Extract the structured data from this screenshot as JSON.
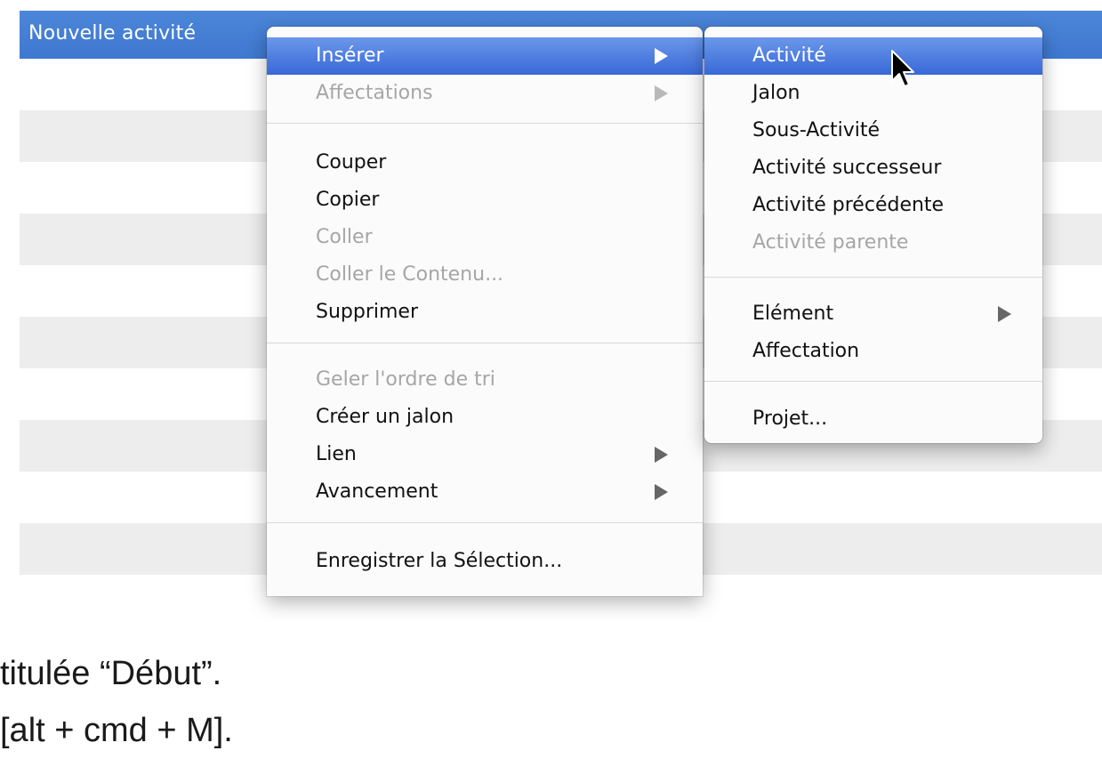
{
  "table": {
    "selected_row_title": "Nouvelle activité"
  },
  "context_menu": {
    "items": [
      {
        "label": "Insérer",
        "submenu": true,
        "state": "highlighted"
      },
      {
        "label": "Affectations",
        "submenu": true,
        "state": "disabled"
      },
      {
        "label": "Couper",
        "state": "enabled"
      },
      {
        "label": "Copier",
        "state": "enabled"
      },
      {
        "label": "Coller",
        "state": "disabled"
      },
      {
        "label": "Coller le Contenu...",
        "state": "disabled"
      },
      {
        "label": "Supprimer",
        "state": "enabled"
      },
      {
        "label": "Geler l'ordre de tri",
        "state": "disabled"
      },
      {
        "label": "Créer un jalon",
        "state": "enabled"
      },
      {
        "label": "Lien",
        "submenu": true,
        "state": "enabled"
      },
      {
        "label": "Avancement",
        "submenu": true,
        "state": "enabled"
      },
      {
        "label": "Enregistrer la Sélection...",
        "state": "enabled"
      }
    ]
  },
  "submenu_inserer": {
    "items": [
      {
        "label": "Activité",
        "state": "highlighted"
      },
      {
        "label": "Jalon",
        "state": "enabled"
      },
      {
        "label": "Sous-Activité",
        "state": "enabled"
      },
      {
        "label": "Activité successeur",
        "state": "enabled"
      },
      {
        "label": "Activité précédente",
        "state": "enabled"
      },
      {
        "label": "Activité parente",
        "state": "disabled"
      },
      {
        "label": "Elément",
        "submenu": true,
        "state": "enabled"
      },
      {
        "label": "Affectation",
        "state": "enabled"
      },
      {
        "label": "Projet...",
        "state": "enabled"
      }
    ]
  },
  "caption": {
    "line1": "titulée “Début”.",
    "line2": "[alt + cmd + M]."
  },
  "colors": {
    "selection_blue": "#3f78cf",
    "menu_highlight": "#3868d8",
    "disabled_text": "#a6a6a6"
  },
  "icons": {
    "submenu_arrow": "triangle-right",
    "cursor": "arrow-pointer"
  }
}
